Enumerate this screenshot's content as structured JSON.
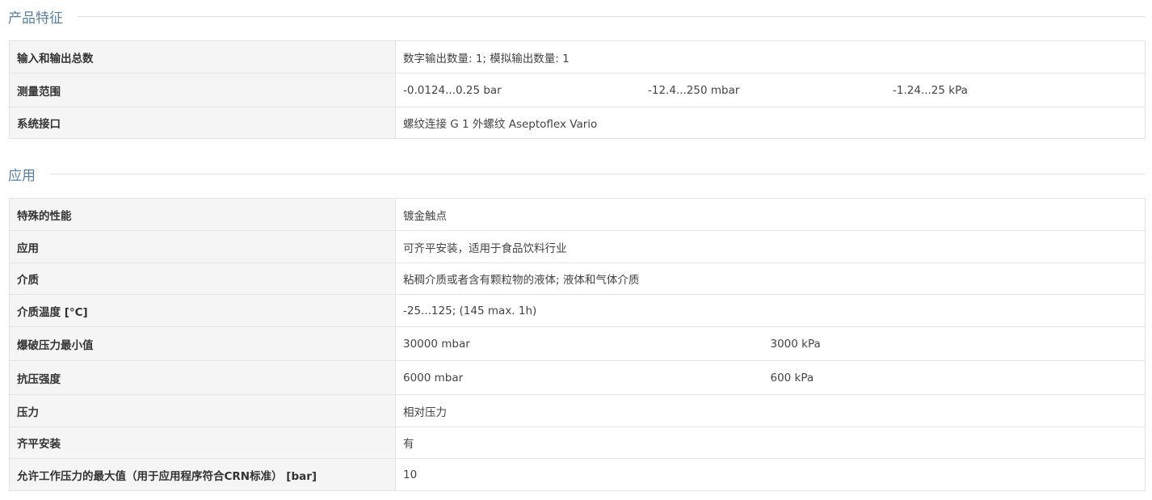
{
  "sections": [
    {
      "title": "产品特征",
      "rows": [
        {
          "label": "输入和输出总数",
          "values": [
            "数字输出数量: 1; 模拟输出数量: 1"
          ]
        },
        {
          "label": "测量范围",
          "values": [
            "-0.0124...0.25 bar",
            "-12.4...250 mbar",
            "-1.24...25 kPa"
          ]
        },
        {
          "label": "系统接口",
          "values": [
            "螺纹连接 G 1 外螺纹 Aseptoflex Vario"
          ]
        }
      ]
    },
    {
      "title": "应用",
      "rows": [
        {
          "label": "特殊的性能",
          "values": [
            "镀金触点"
          ]
        },
        {
          "label": "应用",
          "values": [
            "可齐平安装，适用于食品饮料行业"
          ]
        },
        {
          "label": "介质",
          "values": [
            "粘稠介质或者含有颗粒物的液体; 液体和气体介质"
          ]
        },
        {
          "label": "介质温度 [°C]",
          "values": [
            "-25...125; (145 max. 1h)"
          ]
        },
        {
          "label": "爆破压力最小值",
          "values": [
            "30000 mbar",
            "3000 kPa"
          ]
        },
        {
          "label": "抗压强度",
          "values": [
            "6000 mbar",
            "600 kPa"
          ]
        },
        {
          "label": "压力",
          "values": [
            "相对压力"
          ]
        },
        {
          "label": "齐平安装",
          "values": [
            "有"
          ]
        },
        {
          "label": "允许工作压力的最大值（用于应用程序符合CRN标准） [bar]",
          "values": [
            "10"
          ]
        }
      ]
    }
  ],
  "colors": {
    "section_title": "#5a7f9a",
    "label_bg": "#f5f5f5",
    "border": "#e4e4e4"
  }
}
